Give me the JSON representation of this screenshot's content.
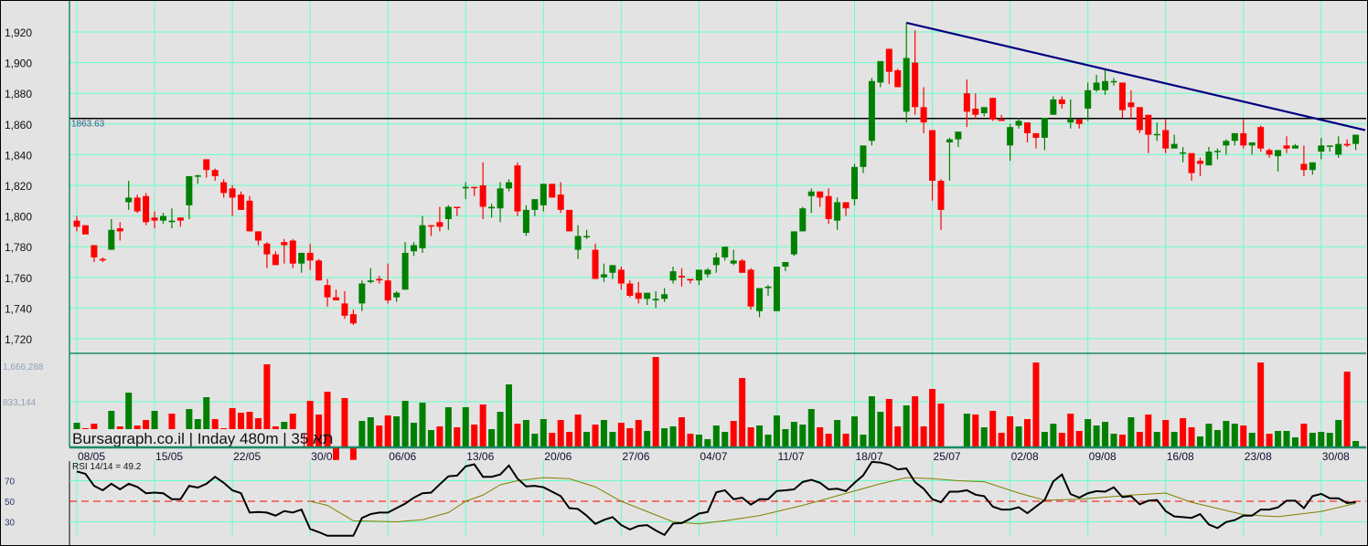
{
  "chart_data": {
    "type": "candlestick",
    "title": "Bursagraph.co.il | Inday 480m | 35 תא",
    "price_axis": {
      "ticks": [
        "1,720",
        "1,740",
        "1,760",
        "1,780",
        "1,800",
        "1,820",
        "1,840",
        "1,860",
        "1,880",
        "1,900",
        "1,920"
      ],
      "range": [
        1710,
        1940
      ],
      "grid": true
    },
    "reference_line": {
      "value": 1863.63,
      "label": "1863.63"
    },
    "trend_line": {
      "from": [
        97,
        1926
      ],
      "to": [
        150.1,
        1856
      ],
      "color": "#000080"
    },
    "dates": [
      "08/05",
      "15/05",
      "22/05",
      "30/05",
      "06/06",
      "13/06",
      "20/06",
      "27/06",
      "04/07",
      "11/07",
      "18/07",
      "25/07",
      "02/08",
      "09/08",
      "16/08",
      "23/08",
      "30/08"
    ],
    "bars_per_date_label": 9,
    "ohlc": [
      [
        1797,
        1800,
        1790,
        1793
      ],
      [
        1794,
        1794,
        1788,
        1788
      ],
      [
        1781,
        1781,
        1770,
        1773
      ],
      [
        1772,
        1773,
        1770,
        1771
      ],
      [
        1778,
        1798,
        1778,
        1791
      ],
      [
        1792,
        1796,
        1784,
        1790
      ],
      [
        1809,
        1823,
        1804,
        1812
      ],
      [
        1812,
        1814,
        1802,
        1803
      ],
      [
        1813,
        1815,
        1794,
        1796
      ],
      [
        1799,
        1803,
        1792,
        1797
      ],
      [
        1797,
        1802,
        1795,
        1800
      ],
      [
        1796,
        1805,
        1792,
        1797
      ],
      [
        1799,
        1799,
        1793,
        1797
      ],
      [
        1807,
        1826,
        1798,
        1826
      ],
      [
        1826,
        1827,
        1821,
        1826.5
      ],
      [
        1837,
        1837,
        1825,
        1830
      ],
      [
        1830,
        1831,
        1823,
        1826
      ],
      [
        1822,
        1824,
        1812,
        1815
      ],
      [
        1818,
        1820,
        1800,
        1812
      ],
      [
        1814,
        1816,
        1804,
        1804
      ],
      [
        1810,
        1813,
        1790,
        1790
      ],
      [
        1790,
        1790,
        1781,
        1784
      ],
      [
        1782,
        1783,
        1766,
        1775
      ],
      [
        1775,
        1777,
        1768,
        1768
      ],
      [
        1783,
        1785,
        1769,
        1781
      ],
      [
        1784,
        1785,
        1766,
        1769
      ],
      [
        1769,
        1776,
        1763,
        1776
      ],
      [
        1776,
        1782,
        1765,
        1771
      ],
      [
        1771,
        1772,
        1758,
        1758
      ],
      [
        1755,
        1759,
        1741,
        1747
      ],
      [
        1747,
        1752,
        1745,
        1745
      ],
      [
        1743,
        1751,
        1733,
        1735
      ],
      [
        1736,
        1739,
        1729,
        1730
      ],
      [
        1743,
        1758,
        1738,
        1756
      ],
      [
        1757,
        1766,
        1756,
        1758
      ],
      [
        1759,
        1761,
        1756,
        1758
      ],
      [
        1758,
        1769,
        1743,
        1745
      ],
      [
        1747,
        1751,
        1744,
        1750
      ],
      [
        1752,
        1783,
        1752,
        1776
      ],
      [
        1777,
        1783,
        1774,
        1781
      ],
      [
        1779,
        1800,
        1776,
        1794
      ],
      [
        1794,
        1794,
        1787,
        1793.8
      ],
      [
        1796,
        1806,
        1790,
        1793
      ],
      [
        1798,
        1807,
        1791,
        1806
      ],
      [
        1806,
        1806,
        1800,
        1805.8
      ],
      [
        1818,
        1822,
        1811,
        1819
      ],
      [
        1819,
        1819,
        1813,
        1818.8
      ],
      [
        1820,
        1835,
        1798,
        1806
      ],
      [
        1805,
        1808,
        1799,
        1806
      ],
      [
        1805,
        1822,
        1796,
        1818
      ],
      [
        1818,
        1824,
        1816,
        1822
      ],
      [
        1833,
        1835,
        1800,
        1803
      ],
      [
        1789,
        1807,
        1787,
        1804
      ],
      [
        1804,
        1811,
        1800,
        1811
      ],
      [
        1807,
        1821,
        1803,
        1821
      ],
      [
        1821,
        1821,
        1812,
        1812
      ],
      [
        1814,
        1822,
        1802,
        1804
      ],
      [
        1804,
        1804,
        1790,
        1790
      ],
      [
        1778,
        1794,
        1772,
        1787
      ],
      [
        1787,
        1791,
        1785,
        1787
      ],
      [
        1778,
        1782,
        1759,
        1759
      ],
      [
        1760,
        1769,
        1757,
        1762
      ],
      [
        1763,
        1768,
        1759,
        1768
      ],
      [
        1765,
        1767,
        1752,
        1756
      ],
      [
        1756,
        1758,
        1747,
        1748
      ],
      [
        1750,
        1757,
        1743,
        1746
      ],
      [
        1746,
        1750,
        1742,
        1750
      ],
      [
        1745,
        1751,
        1740,
        1746
      ],
      [
        1746,
        1753,
        1744,
        1749
      ],
      [
        1758,
        1767,
        1756,
        1764
      ],
      [
        1761,
        1766,
        1754,
        1760
      ],
      [
        1759,
        1759,
        1756,
        1758
      ],
      [
        1758,
        1765,
        1755,
        1765
      ],
      [
        1762,
        1766,
        1760,
        1765
      ],
      [
        1768,
        1776,
        1763,
        1773
      ],
      [
        1773,
        1780,
        1771,
        1780
      ],
      [
        1769,
        1778,
        1768,
        1771
      ],
      [
        1771,
        1772,
        1763,
        1763
      ],
      [
        1765,
        1766,
        1739,
        1741
      ],
      [
        1738,
        1753,
        1734,
        1753
      ],
      [
        1753,
        1755,
        1748,
        1754
      ],
      [
        1738,
        1767,
        1738,
        1767
      ],
      [
        1767,
        1770,
        1764,
        1770
      ],
      [
        1775,
        1790,
        1774,
        1790
      ],
      [
        1790,
        1806,
        1790,
        1805
      ],
      [
        1813,
        1818,
        1802,
        1816
      ],
      [
        1816,
        1816,
        1806,
        1812
      ],
      [
        1813,
        1818,
        1795,
        1798
      ],
      [
        1797,
        1812,
        1791,
        1809
      ],
      [
        1809,
        1809,
        1800,
        1805
      ],
      [
        1811,
        1834,
        1807,
        1832
      ],
      [
        1832,
        1846,
        1828,
        1846
      ],
      [
        1849,
        1890,
        1846,
        1888
      ],
      [
        1887,
        1901,
        1884,
        1901
      ],
      [
        1909,
        1909,
        1886,
        1894
      ],
      [
        1895,
        1896,
        1884,
        1884
      ],
      [
        1868,
        1926,
        1861,
        1903
      ],
      [
        1900,
        1921,
        1866,
        1871
      ],
      [
        1871,
        1884,
        1854,
        1861
      ],
      [
        1856,
        1856,
        1810,
        1823
      ],
      [
        1823,
        1824,
        1791,
        1804
      ],
      [
        1848,
        1851,
        1823,
        1850
      ],
      [
        1850,
        1855,
        1845,
        1855
      ],
      [
        1880,
        1889,
        1858,
        1868
      ],
      [
        1870,
        1880,
        1863,
        1866
      ],
      [
        1867,
        1871,
        1865,
        1871
      ],
      [
        1877,
        1877,
        1862,
        1863
      ],
      [
        1863,
        1866,
        1862,
        1862
      ],
      [
        1846,
        1860,
        1836,
        1858
      ],
      [
        1859,
        1864,
        1857,
        1862
      ],
      [
        1861,
        1861,
        1848,
        1854
      ],
      [
        1854,
        1854,
        1844,
        1851
      ],
      [
        1851,
        1864,
        1843,
        1864
      ],
      [
        1866,
        1878,
        1866,
        1876
      ],
      [
        1876,
        1878,
        1870,
        1873
      ],
      [
        1861,
        1876,
        1857,
        1863
      ],
      [
        1863,
        1863,
        1857,
        1860
      ],
      [
        1870,
        1887,
        1862,
        1882
      ],
      [
        1882,
        1892,
        1881,
        1887
      ],
      [
        1882,
        1895,
        1879,
        1888
      ],
      [
        1887.5,
        1890,
        1885,
        1888
      ],
      [
        1887,
        1887,
        1864,
        1869
      ],
      [
        1874,
        1882,
        1863,
        1871
      ],
      [
        1871,
        1871,
        1854,
        1856
      ],
      [
        1866,
        1866,
        1841,
        1853
      ],
      [
        1853,
        1861,
        1849,
        1853.5
      ],
      [
        1856,
        1863,
        1841,
        1844
      ],
      [
        1844,
        1853,
        1844,
        1847
      ],
      [
        1841,
        1845,
        1835,
        1841.5
      ],
      [
        1841,
        1841,
        1823,
        1828
      ],
      [
        1836,
        1838,
        1826,
        1834
      ],
      [
        1833,
        1845,
        1833,
        1842
      ],
      [
        1842,
        1844,
        1837,
        1842.5
      ],
      [
        1846,
        1850,
        1840,
        1849
      ],
      [
        1849,
        1854,
        1846,
        1854
      ],
      [
        1854,
        1863,
        1844,
        1846
      ],
      [
        1846,
        1848,
        1840,
        1848
      ],
      [
        1858,
        1859,
        1842,
        1844
      ],
      [
        1843,
        1844,
        1838,
        1840
      ],
      [
        1839,
        1843,
        1829,
        1843
      ],
      [
        1846,
        1852,
        1841,
        1844
      ],
      [
        1844,
        1847,
        1844,
        1846
      ],
      [
        1834,
        1846,
        1826,
        1830
      ],
      [
        1830,
        1835,
        1827,
        1835
      ],
      [
        1842,
        1851,
        1837,
        1846
      ],
      [
        1845.5,
        1846,
        1842,
        1846
      ],
      [
        1840,
        1852,
        1838,
        1847
      ],
      [
        1847,
        1850,
        1845,
        1846
      ],
      [
        1847,
        1853,
        1843,
        1853
      ]
    ],
    "volume": {
      "ticks": [
        "833,144",
        "1,666,288"
      ],
      "values_thousands": [
        442,
        340,
        425,
        250,
        663,
        374,
        1003,
        391,
        493,
        663,
        250,
        612,
        250,
        697,
        510,
        918,
        510,
        340,
        714,
        629,
        646,
        527,
        1530,
        374,
        459,
        612,
        250,
        850,
        595,
        1020,
        -250,
        901,
        -250,
        476,
        544,
        391,
        578,
        561,
        850,
        442,
        816,
        306,
        374,
        731,
        357,
        731,
        408,
        782,
        323,
        646,
        1156,
        425,
        493,
        238,
        510,
        255,
        493,
        272,
        595,
        272,
        408,
        493,
        272,
        442,
        340,
        493,
        289,
        1666,
        340,
        374,
        544,
        238,
        221,
        136,
        391,
        272,
        476,
        1275,
        357,
        391,
        221,
        578,
        323,
        459,
        408,
        697,
        357,
        238,
        493,
        238,
        561,
        221,
        935,
        646,
        884,
        374,
        765,
        935,
        374,
        1071,
        799,
        0,
        0,
        612,
        595,
        357,
        663,
        255,
        561,
        374,
        510,
        1564,
        272,
        425,
        255,
        612,
        289,
        510,
        391,
        459,
        238,
        221,
        544,
        272,
        595,
        272,
        493,
        272,
        527,
        357,
        187,
        425,
        306,
        476,
        425,
        391,
        255,
        1564,
        238,
        289,
        289,
        170,
        425,
        255,
        272,
        255,
        493,
        1394,
        102
      ],
      "up": [
        1,
        0,
        0,
        0,
        1,
        0,
        1,
        0,
        0,
        1,
        0,
        0,
        0,
        1,
        1,
        1,
        0,
        0,
        0,
        0,
        0,
        0,
        0,
        0,
        1,
        0,
        0,
        0,
        0,
        0,
        0,
        0,
        0,
        1,
        1,
        0,
        0,
        1,
        1,
        1,
        1,
        1,
        0,
        1,
        0,
        1,
        0,
        0,
        1,
        1,
        1,
        0,
        1,
        1,
        1,
        0,
        0,
        0,
        0,
        1,
        0,
        1,
        1,
        0,
        0,
        0,
        1,
        0,
        1,
        1,
        0,
        0,
        1,
        1,
        1,
        1,
        0,
        0,
        0,
        1,
        1,
        1,
        1,
        1,
        1,
        1,
        0,
        0,
        1,
        0,
        1,
        1,
        1,
        1,
        0,
        0,
        1,
        0,
        0,
        0,
        0,
        0,
        0,
        1,
        0,
        1,
        0,
        0,
        0,
        1,
        0,
        0,
        1,
        1,
        0,
        0,
        0,
        1,
        1,
        1,
        1,
        0,
        1,
        0,
        0,
        1,
        0,
        1,
        0,
        0,
        1,
        1,
        1,
        1,
        1,
        0,
        1,
        0,
        0,
        1,
        1,
        1,
        0,
        1,
        1,
        1,
        1,
        0,
        1
      ]
    },
    "rsi": {
      "label": "RSI 14/14 = 49.2",
      "ticks": [
        "70",
        "50",
        "30"
      ],
      "values": [
        79,
        76.7,
        65,
        60.7,
        67,
        61.6,
        67,
        64,
        57.8,
        58.4,
        57.8,
        52,
        52,
        65,
        63.3,
        67,
        73.8,
        68,
        60.7,
        57.8,
        39,
        39.6,
        39,
        36,
        40.4,
        39,
        41.9,
        23,
        20,
        16.4,
        16.4,
        16.4,
        16.4,
        33.8,
        37.5,
        39,
        39,
        43.3,
        47.7,
        53.5,
        57.8,
        58.4,
        66.5,
        74.3,
        75,
        84,
        86,
        73.8,
        73.8,
        76,
        84.8,
        72,
        64.5,
        65,
        63.6,
        59.3,
        55,
        43.3,
        42.5,
        36,
        28,
        31.8,
        34.6,
        26.8,
        22.5,
        26,
        26.8,
        21.6,
        17.2,
        28.3,
        28.8,
        33,
        38,
        39.6,
        58.7,
        60.7,
        52,
        53.5,
        46.8,
        52,
        52,
        60,
        60.7,
        61.6,
        68.8,
        70.9,
        68,
        61.6,
        62.2,
        59.9,
        68,
        75.2,
        88.3,
        87.7,
        85.4,
        81,
        81.9,
        68.6,
        62.2,
        52,
        49,
        59.3,
        59.3,
        60.7,
        56.4,
        55,
        44.8,
        41.9,
        41.9,
        44.2,
        38.4,
        44.8,
        51.2,
        69.4,
        76,
        57,
        53.5,
        57.8,
        59.9,
        59.3,
        63.6,
        54,
        55,
        47,
        50.6,
        51.2,
        40.4,
        35.2,
        34.6,
        33.8,
        37.5,
        27.4,
        23.9,
        29.7,
        31.7,
        36,
        36,
        41.9,
        41.9,
        44,
        50.6,
        50.6,
        43.3,
        55,
        57.2,
        52.9,
        52.9,
        48.3,
        49.2
      ],
      "signal": [
        [
          28,
          50
        ],
        [
          30,
          46
        ],
        [
          33,
          31
        ],
        [
          38,
          30
        ],
        [
          41,
          32
        ],
        [
          44,
          39
        ],
        [
          46,
          50
        ],
        [
          48,
          56
        ],
        [
          50,
          66
        ],
        [
          52,
          70
        ],
        [
          55,
          73
        ],
        [
          58,
          72
        ],
        [
          61,
          64
        ],
        [
          64,
          50
        ],
        [
          67,
          40
        ],
        [
          70,
          30
        ],
        [
          73,
          28
        ],
        [
          76,
          31
        ],
        [
          80,
          36
        ],
        [
          85,
          46
        ],
        [
          91,
          60
        ],
        [
          94,
          67
        ],
        [
          97,
          73
        ],
        [
          100,
          72
        ],
        [
          103,
          70
        ],
        [
          106,
          69
        ],
        [
          110,
          58
        ],
        [
          113,
          51
        ],
        [
          117,
          52
        ],
        [
          123,
          56
        ],
        [
          127,
          58
        ],
        [
          130,
          49
        ],
        [
          136,
          37
        ],
        [
          140,
          35
        ],
        [
          145,
          40
        ],
        [
          149,
          48
        ]
      ]
    },
    "colors": {
      "up": "#008000",
      "down": "#ff0000",
      "grid": "#66ffc4",
      "trend": "#000080",
      "signal": "#808000",
      "background": "#e3e3e3"
    }
  }
}
